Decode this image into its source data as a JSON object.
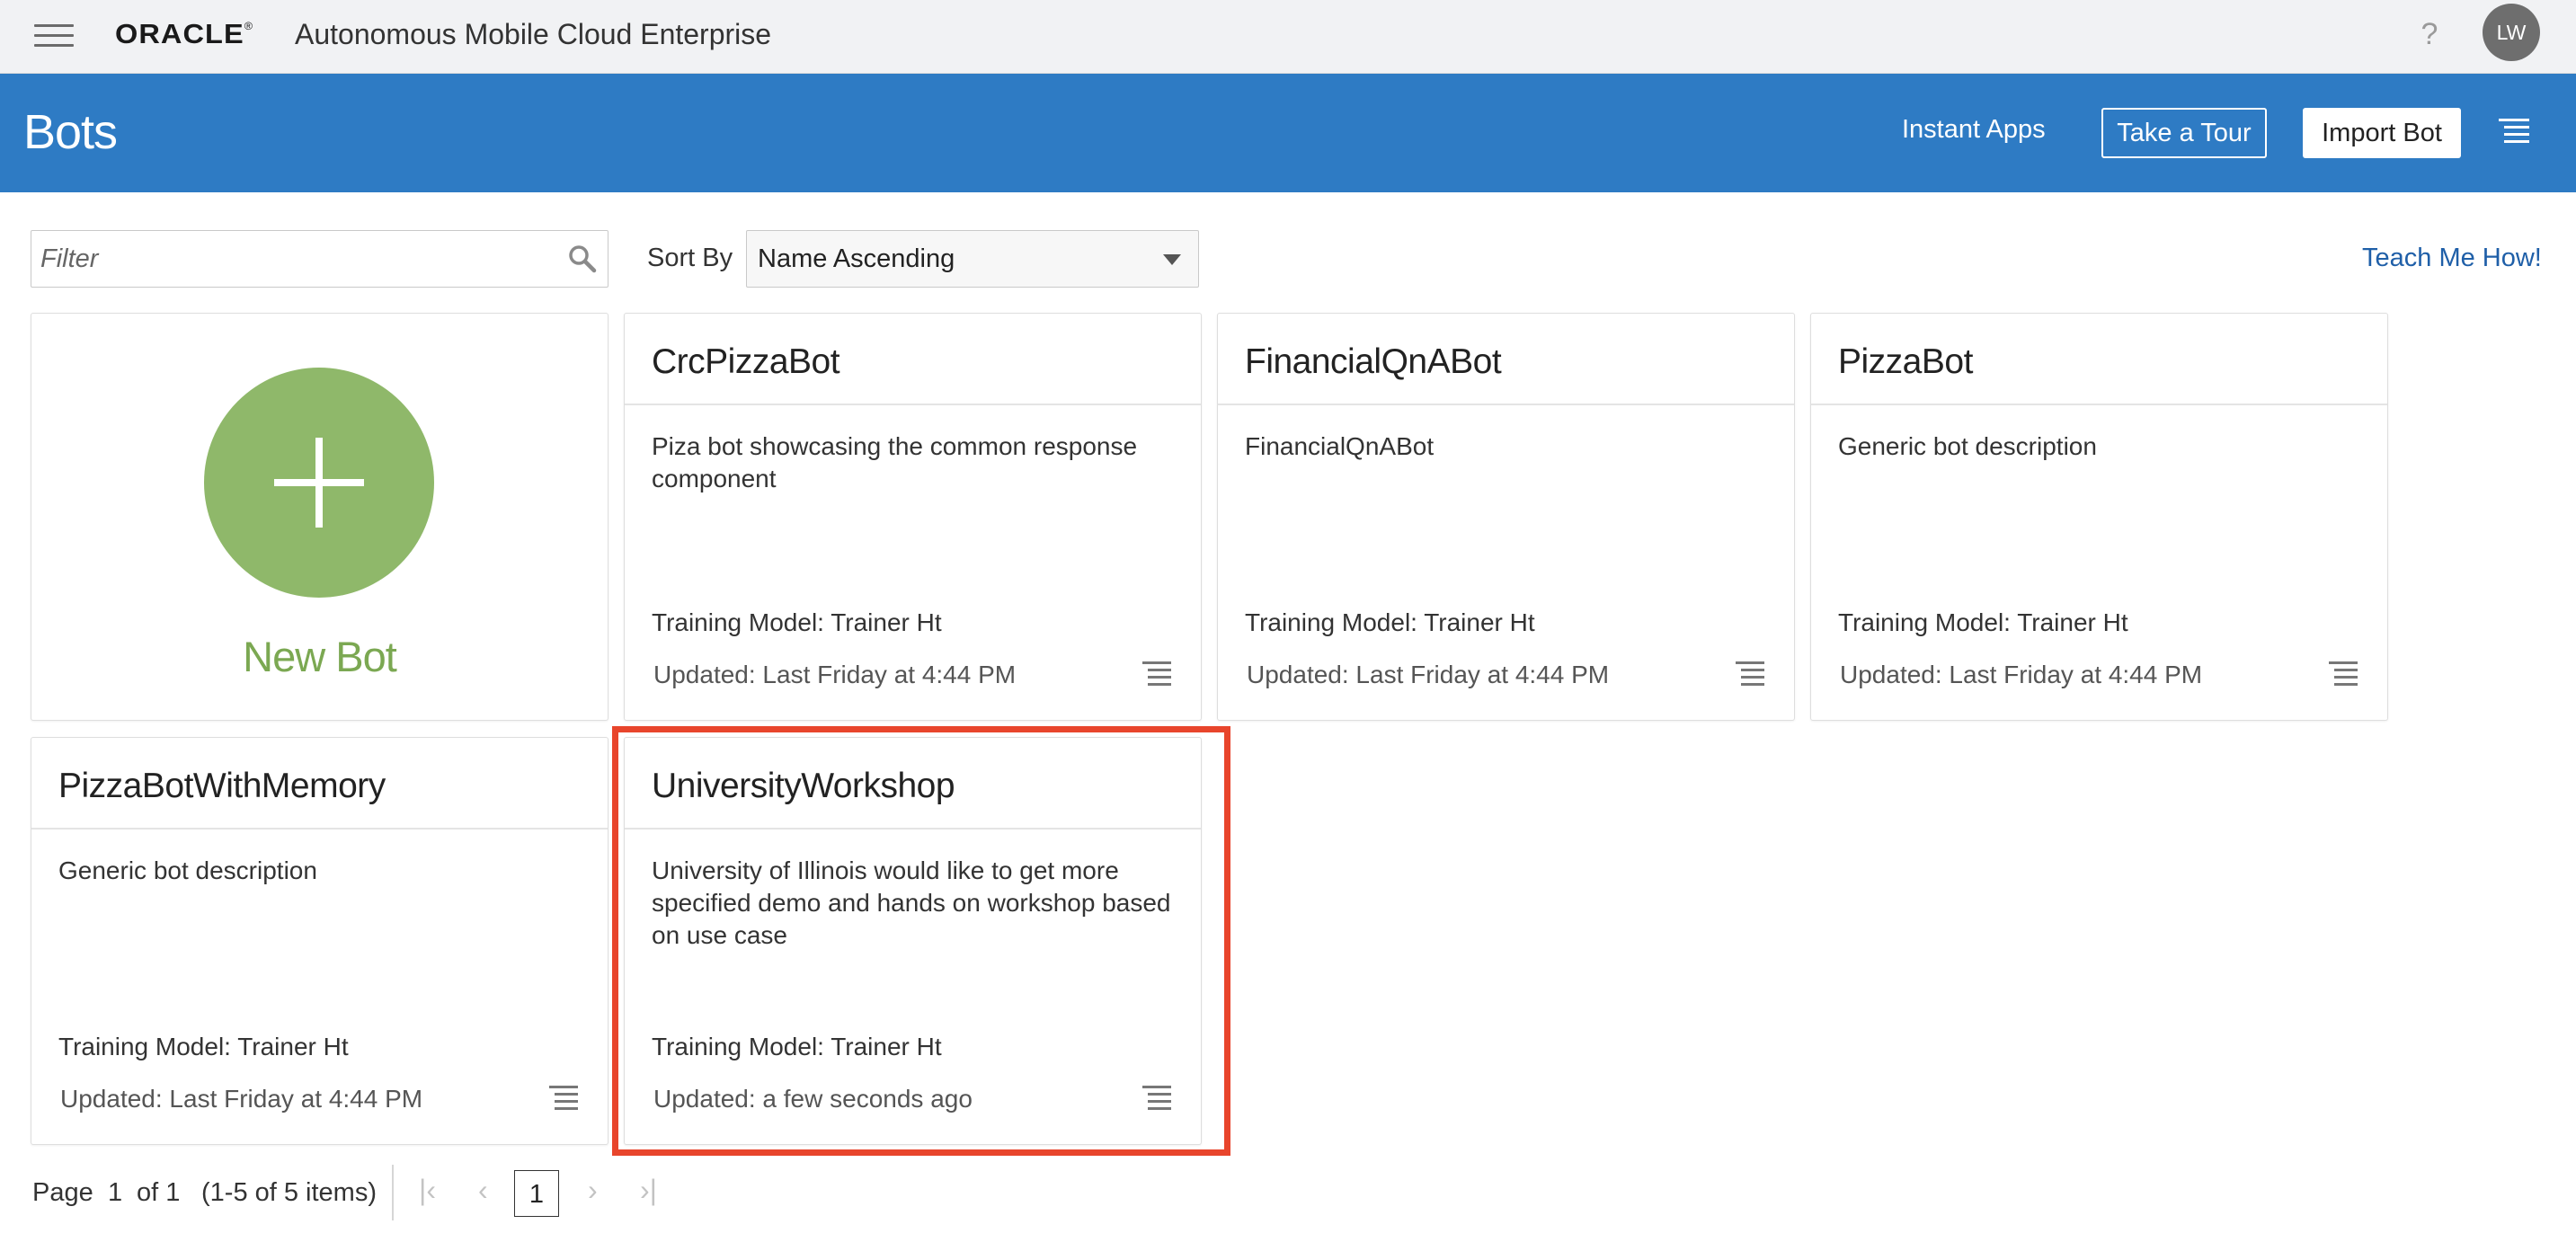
{
  "topbar": {
    "brand": "ORACLE",
    "app_title": "Autonomous Mobile Cloud Enterprise",
    "help_glyph": "?",
    "avatar_initials": "LW"
  },
  "header": {
    "title": "Bots",
    "instant_apps": "Instant Apps",
    "take_tour": "Take a Tour",
    "import_bot": "Import Bot",
    "background_color": "#2e7bc4"
  },
  "toolbar": {
    "filter_placeholder": "Filter",
    "sort_label": "Sort By",
    "sort_value": "Name Ascending",
    "teach_link": "Teach Me How!"
  },
  "new_bot": {
    "label": "New Bot",
    "accent_color": "#8fb86a"
  },
  "bots": [
    {
      "name": "CrcPizzaBot",
      "description": "Piza bot showcasing the common response component",
      "training_model": "Training Model: Trainer Ht",
      "updated": "Updated: Last Friday at 4:44 PM"
    },
    {
      "name": "FinancialQnABot",
      "description": "FinancialQnABot",
      "training_model": "Training Model: Trainer Ht",
      "updated": "Updated: Last Friday at 4:44 PM"
    },
    {
      "name": "PizzaBot",
      "description": "Generic bot description",
      "training_model": "Training Model: Trainer Ht",
      "updated": "Updated: Last Friday at 4:44 PM"
    },
    {
      "name": "PizzaBotWithMemory",
      "description": "Generic bot description",
      "training_model": "Training Model: Trainer Ht",
      "updated": "Updated: Last Friday at 4:44 PM"
    },
    {
      "name": "UniversityWorkshop",
      "description": "University of Illinois would like to get more specified demo and hands on workshop based on use case",
      "training_model": "Training Model: Trainer Ht",
      "updated": "Updated: a few seconds ago"
    }
  ],
  "highlight_color": "#e8452c",
  "pagination": {
    "page_label": "Page",
    "page_number": "1",
    "of_pages": "of 1",
    "items_summary": "(1-5 of 5 items)",
    "current_page": "1"
  }
}
